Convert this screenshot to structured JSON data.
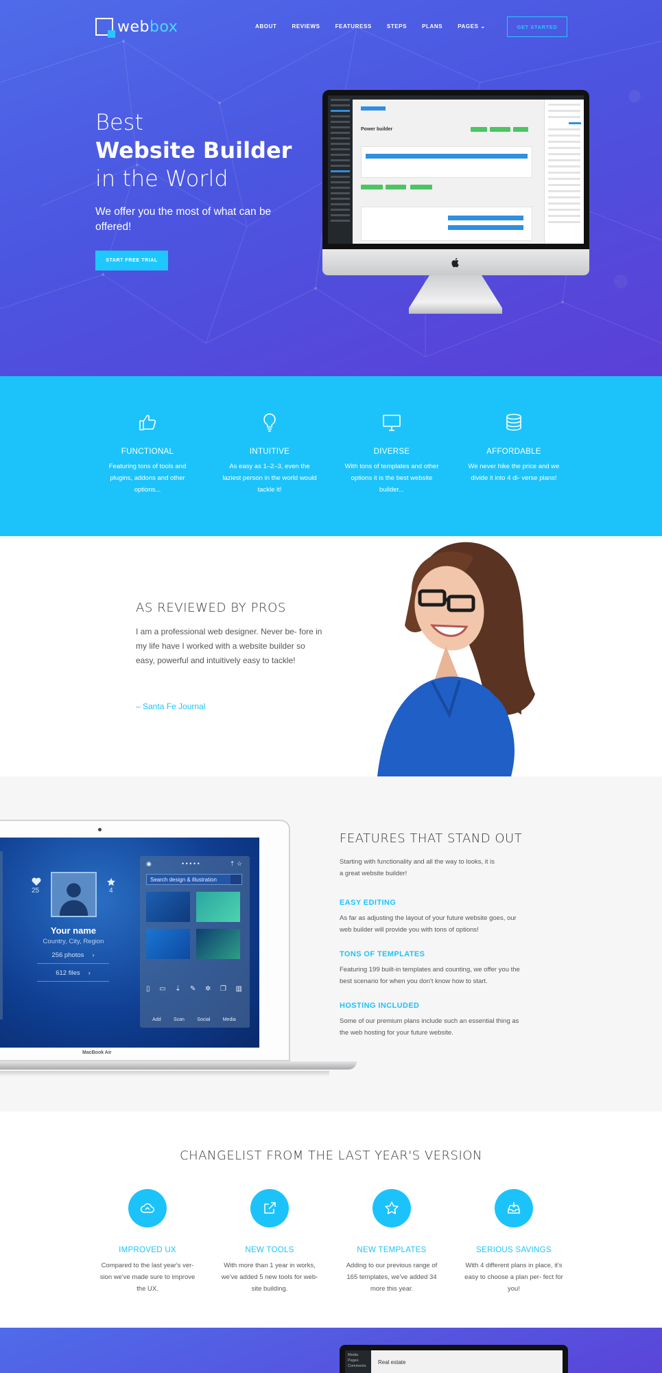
{
  "brand": {
    "name_part1": "web",
    "name_part2": "box"
  },
  "nav": {
    "items": [
      "ABOUT",
      "REVIEWS",
      "FEATURESS",
      "STEPS",
      "PLANS",
      "PAGES ⌄"
    ],
    "cta": "GET STARTED"
  },
  "hero": {
    "title_line1": "Best",
    "title_line2": "Website Builder",
    "title_line3": "in the World",
    "subtitle": "We offer you the most of what can be offered!",
    "button": "START FREE TRIAL",
    "screen_title": "Power builder"
  },
  "features": [
    {
      "icon": "thumbs-up-icon",
      "title": "FUNCTIONAL",
      "text": "Featuring tons of tools and plugins, addons and other options..."
    },
    {
      "icon": "lightbulb-icon",
      "title": "INTUITIVE",
      "text": "As easy as 1–2–3, even the laziest person in the world would tackle it!"
    },
    {
      "icon": "monitor-icon",
      "title": "DIVERSE",
      "text": "With tons of templates and other options it is the best website builder..."
    },
    {
      "icon": "database-icon",
      "title": "AFFORDABLE",
      "text": "We never hike the price and we divide it into 4 di- verse plans!"
    }
  ],
  "review": {
    "heading": "AS REVIEWED BY PROS",
    "quote": "I am a professional web designer. Never be- fore in my life have I worked with a website builder so easy, powerful and intuitively easy to tackle!",
    "source": "– Santa Fe Journal"
  },
  "standout": {
    "heading": "FEATURES THAT STAND OUT",
    "intro": "Starting with functionality and all the way to looks, it is a great website builder!",
    "items": [
      {
        "title": "EASY EDITING",
        "text": "As far as adjusting the layout of your future website goes, our web builder will provide you with tons of options!"
      },
      {
        "title": "TONS OF TEMPLATES",
        "text": "Featuring 199 built-in templates and counting, we offer you the best scenario for when you don't know how to start."
      },
      {
        "title": "HOSTING INCLUDED",
        "text": "Some of our premium plans include such an essential thing as the web hosting for your future website."
      }
    ],
    "device": {
      "label": "MacBook Air",
      "name": "Your name",
      "location": "Country, City, Region",
      "likes": "25",
      "stars": "4",
      "photos": "256 photos",
      "files": "612 files",
      "search": "Search design & illustration",
      "tools": [
        "Add",
        "Scan",
        "Social",
        "Media"
      ]
    }
  },
  "changelist": {
    "heading": "CHANGELIST FROM THE LAST YEAR'S VERSION",
    "items": [
      {
        "icon": "cloud-icon",
        "title": "IMPROVED UX",
        "text": "Compared to the last year's ver- sion we've made sure to improve the UX."
      },
      {
        "icon": "external-link-icon",
        "title": "NEW TOOLS",
        "text": "With more than 1 year in works, we've added 5 new tools for web- site building."
      },
      {
        "icon": "star-icon",
        "title": "NEW TEMPLATES",
        "text": "Adding to our previous range of 165 templates, we've added 34 more this year."
      },
      {
        "icon": "inbox-icon",
        "title": "SERIOUS SAVINGS",
        "text": "With 4 different plans in place, it's easy to choose a plan per- fect for you!"
      }
    ]
  },
  "footer_preview": {
    "sidebar": [
      "Media",
      "Pages",
      "Comments"
    ],
    "text": "Real estate"
  },
  "colors": {
    "accent": "#1cc3fb",
    "hero_start": "#4f6bea",
    "hero_end": "#5b3fd6",
    "strip": "#1cc3fb"
  }
}
